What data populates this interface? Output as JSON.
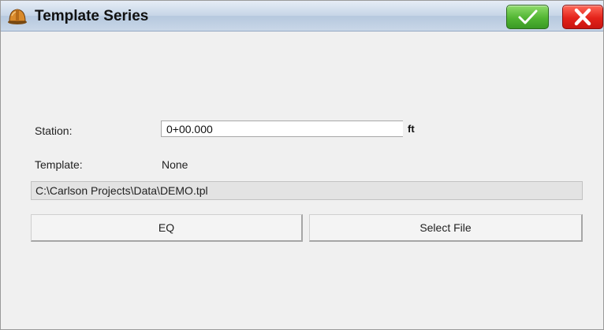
{
  "window": {
    "title": "Template Series",
    "app_icon": "hard-hat-icon",
    "ok_icon": "checkmark-icon",
    "cancel_icon": "close-x-icon"
  },
  "form": {
    "station_label": "Station:",
    "station_value": "0+00.000",
    "station_unit": "ft",
    "template_label": "Template:",
    "template_value": "None",
    "file_path": "C:\\Carlson Projects\\Data\\DEMO.tpl"
  },
  "buttons": {
    "eq_label": "EQ",
    "select_file_label": "Select File"
  },
  "colors": {
    "ok_green": "#4caf2e",
    "cancel_red": "#e4231a",
    "titlebar_blue": "#c6d5e7",
    "background": "#f0f0f0"
  }
}
